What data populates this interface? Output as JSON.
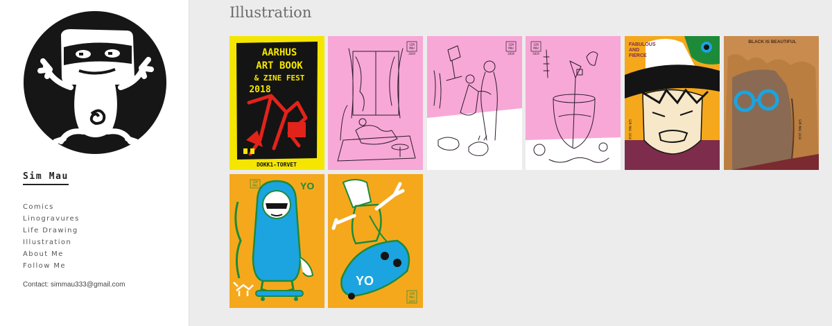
{
  "site": {
    "title": "Sim Mau"
  },
  "nav": {
    "items": [
      {
        "label": "Comics"
      },
      {
        "label": "Linogravures"
      },
      {
        "label": "Life Drawing"
      },
      {
        "label": "Illustration"
      },
      {
        "label": "About Me"
      },
      {
        "label": "Follow Me"
      }
    ]
  },
  "contact": "Contact: simmau333@gmail.com",
  "page": {
    "title": "Illustration"
  },
  "gallery": {
    "items": [
      {
        "icon": "aarhus-art-book-zine-fest-poster",
        "text_lines": [
          "AARHUS",
          "ART BOOK",
          "& ZINE FEST",
          "2018"
        ],
        "footer": "DOKK1-TORVET",
        "bg": "#f4e600"
      },
      {
        "icon": "woman-reading-room-drawing",
        "signature": [
          "SIM",
          "MAU",
          "2019"
        ],
        "bg": "#f7a8d6"
      },
      {
        "icon": "couple-with-sleeping-cat-drawing",
        "signature": [
          "SIM",
          "MAU",
          "2019"
        ],
        "bg": "#f7a8d6"
      },
      {
        "icon": "fishbowl-vase-still-life",
        "signature": [
          "SIM",
          "MAU",
          "2019"
        ],
        "bg": "#f7a8d6"
      },
      {
        "icon": "fabulous-and-fierce-portrait",
        "text_lines": [
          "FABULOUS",
          "AND",
          "FIERCE"
        ],
        "side": "SIM MAU 2018",
        "bg": "#f5a81c"
      },
      {
        "icon": "black-is-beautiful-portrait",
        "text_lines": [
          "BLACK IS BEAUTIFUL"
        ],
        "side": "SIM MAU 2018",
        "bg": "#a9542e"
      },
      {
        "icon": "hooded-figure-with-dog",
        "text_lines": [
          "YO"
        ],
        "signature": [
          "SIM",
          "MAU"
        ],
        "bg": "#f5a81c"
      },
      {
        "icon": "skateboarder-yo-drawing",
        "text_lines": [
          "YO"
        ],
        "signature": [
          "SIM",
          "MAU",
          "2019"
        ],
        "bg": "#f5a81c"
      }
    ]
  },
  "colors": {
    "sidebar_bg": "#ffffff",
    "content_bg": "#ececec",
    "pink": "#f7a8d6",
    "yellow": "#f4e600",
    "orange": "#f5a81c",
    "blue": "#1ba4e0",
    "green": "#1d8a3a",
    "red": "#e2231a"
  }
}
